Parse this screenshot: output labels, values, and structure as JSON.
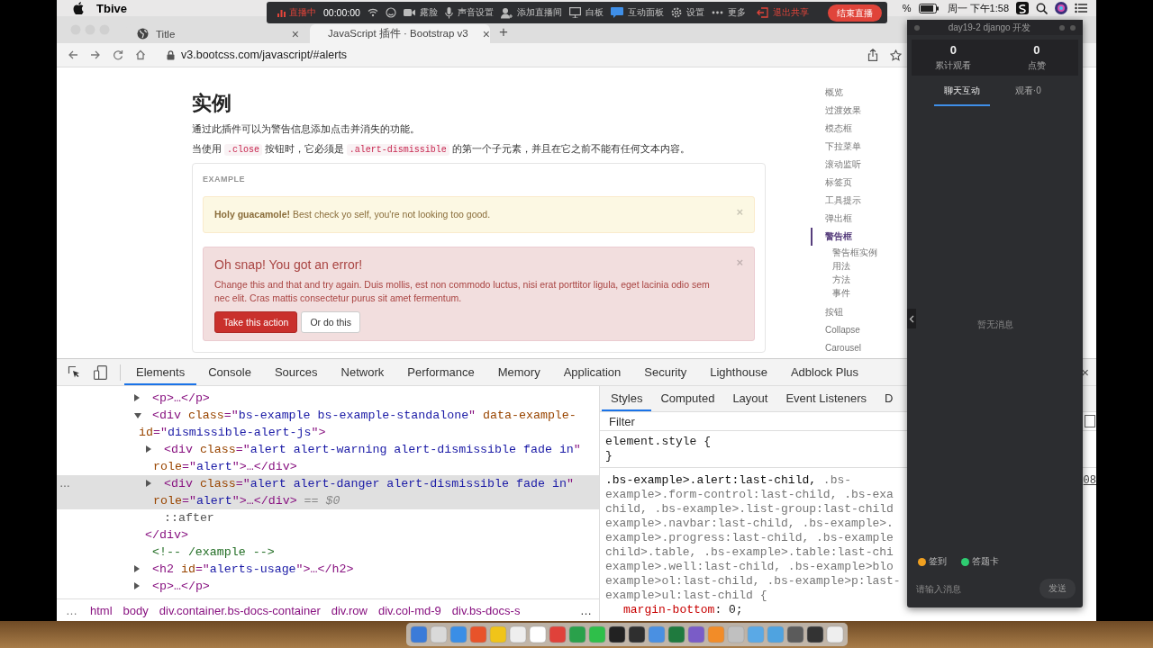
{
  "menubar": {
    "app": "Tbive",
    "battery_text": "%",
    "clock": "周一 下午1:58"
  },
  "live_toolbar": {
    "items": [
      {
        "kind": "live",
        "label": "直播中"
      },
      {
        "kind": "timer",
        "label": "00:00:00"
      },
      {
        "kind": "tool",
        "label": "露脸"
      },
      {
        "kind": "tool",
        "label": "声音设置"
      },
      {
        "kind": "tool",
        "label": "添加直播间"
      },
      {
        "kind": "tool",
        "label": "白板"
      },
      {
        "kind": "tool",
        "label": "互动面板"
      },
      {
        "kind": "tool",
        "label": "设置"
      },
      {
        "kind": "tool",
        "label": "更多"
      },
      {
        "kind": "exit",
        "label": "退出共享"
      },
      {
        "kind": "end",
        "label": "结束直播"
      }
    ]
  },
  "browser": {
    "tabs": [
      {
        "title": "Title",
        "selected": false,
        "close": "×"
      },
      {
        "title": "JavaScript 插件 · Bootstrap v3",
        "selected": true,
        "close": "×"
      }
    ],
    "new_tab": "+",
    "url": "v3.bootcss.com/javascript/#alerts"
  },
  "page": {
    "heading": "实例",
    "intro": "通过此插件可以为警告信息添加点击并消失的功能。",
    "note": [
      {
        "kind": "text",
        "text": "当使用 "
      },
      {
        "kind": "code",
        "text": ".close"
      },
      {
        "kind": "text",
        "text": " 按钮时，它必须是 "
      },
      {
        "kind": "code",
        "text": ".alert-dismissible"
      },
      {
        "kind": "text",
        "text": " 的第一个子元素，并且在它之前不能有任何文本内容。"
      }
    ],
    "example_label": "EXAMPLE",
    "alerts": [
      {
        "kind": "warning",
        "text": "**Holy guacamole!** Best check yo self, you're not looking too good.",
        "close": "×"
      },
      {
        "kind": "danger",
        "heading": "Oh snap! You got an error!",
        "text": "Change this and that and try again. Duis mollis, est non commodo luctus, nisi erat porttitor ligula, eget lacinia odio sem nec elit. Cras mattis consectetur purus sit amet fermentum.",
        "close": "×",
        "buttons": [
          {
            "label": "Take this action",
            "kind": "danger"
          },
          {
            "label": "Or do this",
            "kind": "default"
          }
        ]
      }
    ],
    "nav": [
      {
        "label": "概览",
        "selected": false
      },
      {
        "label": "过渡效果",
        "selected": false
      },
      {
        "label": "模态框",
        "selected": false
      },
      {
        "label": "下拉菜单",
        "selected": false
      },
      {
        "label": "滚动监听",
        "selected": false
      },
      {
        "label": "标签页",
        "selected": false
      },
      {
        "label": "工具提示",
        "selected": false
      },
      {
        "label": "弹出框",
        "selected": false
      },
      {
        "label": "警告框",
        "selected": true,
        "children": [
          {
            "label": "警告框实例",
            "selected": false
          },
          {
            "label": "用法",
            "selected": false
          },
          {
            "label": "方法",
            "selected": false
          },
          {
            "label": "事件",
            "selected": false
          }
        ]
      },
      {
        "label": "按钮",
        "selected": false
      },
      {
        "label": "Collapse",
        "selected": false
      },
      {
        "label": "Carousel",
        "selected": false
      }
    ]
  },
  "devtools": {
    "tabs": [
      {
        "label": "Elements",
        "selected": true
      },
      {
        "label": "Console",
        "selected": false
      },
      {
        "label": "Sources",
        "selected": false
      },
      {
        "label": "Network",
        "selected": false
      },
      {
        "label": "Performance",
        "selected": false
      },
      {
        "label": "Memory",
        "selected": false
      },
      {
        "label": "Application",
        "selected": false
      },
      {
        "label": "Security",
        "selected": false
      },
      {
        "label": "Lighthouse",
        "selected": false
      },
      {
        "label": "Adblock Plus",
        "selected": false
      }
    ],
    "close": "×",
    "dom_tree": [
      {
        "expanded": false,
        "selected": false,
        "lines": [
          [
            {
              "kind": "tag",
              "text": "<p>"
            },
            {
              "kind": "punct",
              "text": "…"
            },
            {
              "kind": "tag",
              "text": "</p>"
            }
          ]
        ]
      },
      {
        "expanded": true,
        "selected": false,
        "lines": [
          [
            {
              "kind": "tag",
              "text": "<div "
            },
            {
              "kind": "attr",
              "text": "class"
            },
            {
              "kind": "punct",
              "text": "=\""
            },
            {
              "kind": "value",
              "text": "bs-example bs-example-standalone"
            },
            {
              "kind": "punct",
              "text": "\" "
            },
            {
              "kind": "attr",
              "text": "data-example-"
            }
          ],
          [
            {
              "kind": "attr",
              "text": "id"
            },
            {
              "kind": "punct",
              "text": "=\""
            },
            {
              "kind": "value",
              "text": "dismissible-alert-js"
            },
            {
              "kind": "punct",
              "text": "\""
            },
            {
              "kind": "tag",
              "text": ">"
            }
          ]
        ],
        "children": [
          {
            "expanded": false,
            "selected": false,
            "lines": [
              [
                {
                  "kind": "tag",
                  "text": "<div "
                },
                {
                  "kind": "attr",
                  "text": "class"
                },
                {
                  "kind": "punct",
                  "text": "=\""
                },
                {
                  "kind": "value",
                  "text": "alert alert-warning alert-dismissible fade in"
                },
                {
                  "kind": "punct",
                  "text": "\""
                }
              ],
              [
                {
                  "kind": "attr",
                  "text": "role"
                },
                {
                  "kind": "punct",
                  "text": "=\""
                },
                {
                  "kind": "value",
                  "text": "alert"
                },
                {
                  "kind": "punct",
                  "text": "\""
                },
                {
                  "kind": "tag",
                  "text": ">"
                },
                {
                  "kind": "punct",
                  "text": "…"
                },
                {
                  "kind": "tag",
                  "text": "</div>"
                }
              ]
            ]
          },
          {
            "expanded": false,
            "selected": true,
            "menu": "…",
            "lines": [
              [
                {
                  "kind": "tag",
                  "text": "<div "
                },
                {
                  "kind": "attr",
                  "text": "class"
                },
                {
                  "kind": "punct",
                  "text": "=\""
                },
                {
                  "kind": "value",
                  "text": "alert alert-danger alert-dismissible fade in"
                },
                {
                  "kind": "punct",
                  "text": "\""
                }
              ],
              [
                {
                  "kind": "attr",
                  "text": "role"
                },
                {
                  "kind": "punct",
                  "text": "=\""
                },
                {
                  "kind": "value",
                  "text": "alert"
                },
                {
                  "kind": "punct",
                  "text": "\""
                },
                {
                  "kind": "tag",
                  "text": ">"
                },
                {
                  "kind": "punct",
                  "text": "…"
                },
                {
                  "kind": "tag",
                  "text": "</div>"
                },
                {
                  "kind": "note",
                  "text": " == $0"
                }
              ]
            ]
          },
          {
            "lines": [
              [
                {
                  "kind": "pseudo",
                  "text": "::after"
                }
              ]
            ]
          }
        ],
        "closing": [
          {
            "kind": "tag",
            "text": "</div>"
          }
        ]
      },
      {
        "lines": [
          [
            {
              "kind": "comment",
              "text": "<!-- /example -->"
            }
          ]
        ]
      },
      {
        "expanded": false,
        "selected": false,
        "lines": [
          [
            {
              "kind": "tag",
              "text": "<h2 "
            },
            {
              "kind": "attr",
              "text": "id"
            },
            {
              "kind": "punct",
              "text": "=\""
            },
            {
              "kind": "value",
              "text": "alerts-usage"
            },
            {
              "kind": "punct",
              "text": "\""
            },
            {
              "kind": "tag",
              "text": ">"
            },
            {
              "kind": "punct",
              "text": "…"
            },
            {
              "kind": "tag",
              "text": "</h2>"
            }
          ]
        ]
      },
      {
        "expanded": false,
        "selected": false,
        "lines": [
          [
            {
              "kind": "tag",
              "text": "<p>"
            },
            {
              "kind": "punct",
              "text": "…"
            },
            {
              "kind": "tag",
              "text": "</p>"
            }
          ]
        ]
      }
    ],
    "breadcrumb": {
      "more_left": "…",
      "items": [
        "html",
        "body",
        "div.container.bs-docs-container",
        "div.row",
        "div.col-md-9",
        "div.bs-docs-s"
      ],
      "more_right": "…"
    },
    "style_tabs": [
      {
        "label": "Styles",
        "selected": true
      },
      {
        "label": "Computed",
        "selected": false
      },
      {
        "label": "Layout",
        "selected": false
      },
      {
        "label": "Event Listeners",
        "selected": false
      },
      {
        "label": "D",
        "selected": false
      }
    ],
    "filter_placeholder": "Filter",
    "element_style": [
      "element.style {",
      "}"
    ],
    "rule": {
      "source": "08",
      "selector_lines": [
        [
          {
            "kind": "match",
            "text": ".bs-example>.alert:last-child, "
          },
          {
            "kind": "other",
            "text": ".bs-"
          }
        ],
        [
          {
            "kind": "other",
            "text": "example>.form-control:last-child, .bs-exa"
          }
        ],
        [
          {
            "kind": "other",
            "text": "child, .bs-example>.list-group:last-child"
          }
        ],
        [
          {
            "kind": "other",
            "text": "example>.navbar:last-child, .bs-example>."
          }
        ],
        [
          {
            "kind": "other",
            "text": "example>.progress:last-child, .bs-example"
          }
        ],
        [
          {
            "kind": "other",
            "text": "child>.table, .bs-example>.table:last-chi"
          }
        ],
        [
          {
            "kind": "other",
            "text": "example>.well:last-child, .bs-example>blo"
          }
        ],
        [
          {
            "kind": "other",
            "text": "example>ol:last-child, .bs-example>p:last-"
          }
        ],
        [
          {
            "kind": "other",
            "text": "example>ul:last-child {"
          }
        ]
      ],
      "declarations": [
        {
          "property": "margin-bottom",
          "value": ": 0;"
        }
      ]
    }
  },
  "chat_panel": {
    "title": "day19-2 django 开发",
    "stats": [
      {
        "value": "0",
        "label": "累计观看"
      },
      {
        "value": "0",
        "label": "点赞"
      }
    ],
    "tabs": [
      {
        "label": "聊天互动",
        "selected": true
      },
      {
        "label": "观看·0",
        "selected": false
      }
    ],
    "empty_text": "暂无消息",
    "actions": [
      {
        "label": "签到",
        "color": "#f0a020"
      },
      {
        "label": "答题卡",
        "color": "#2ecc71"
      }
    ],
    "input_placeholder": "请输入消息",
    "send": "发送"
  }
}
